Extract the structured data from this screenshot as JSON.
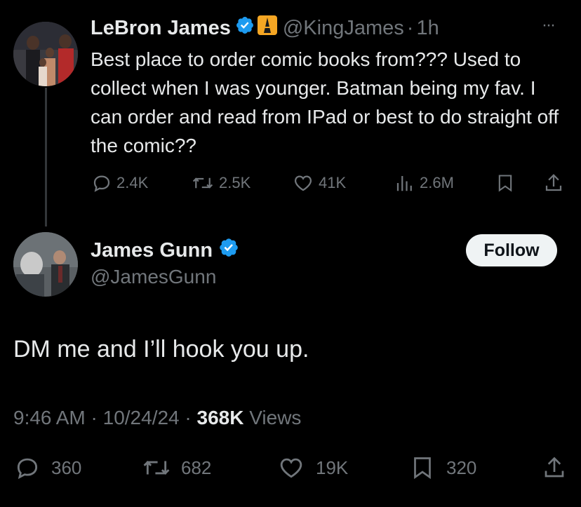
{
  "parent_tweet": {
    "display_name": "LeBron James",
    "handle": "@KingJames",
    "separator": "·",
    "time": "1h",
    "more": "···",
    "text": "Best place to order comic books from??? Used to collect when I was younger. Batman being my fav. I can order and read from IPad or best to do straight off the comic??",
    "replies": "2.4K",
    "reposts": "2.5K",
    "likes": "41K",
    "views": "2.6M"
  },
  "reply_tweet": {
    "display_name": "James Gunn",
    "handle": "@JamesGunn",
    "follow_label": "Follow",
    "text": "DM me and I’ll hook you up.",
    "time": "9:46 AM",
    "sep1": "·",
    "date": "10/24/24",
    "sep2": "·",
    "views_count": "368K",
    "views_label": "Views",
    "replies": "360",
    "reposts": "682",
    "likes": "19K",
    "bookmarks": "320"
  },
  "colors": {
    "background": "#000000",
    "text": "#e7e9ea",
    "muted": "#71767b",
    "verified": "#1d9bf0",
    "follow_bg": "#eff3f4"
  }
}
